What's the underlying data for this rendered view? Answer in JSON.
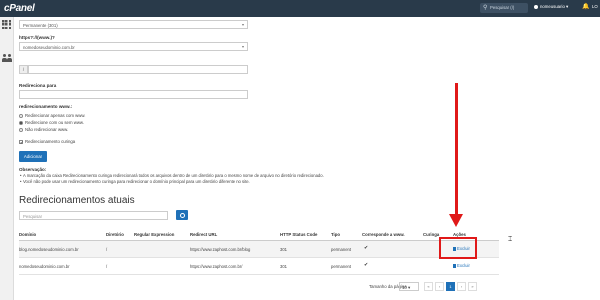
{
  "topbar": {
    "logo": "cPanel",
    "search_placeholder": "Pesquisar (/)",
    "user": "nomeusuario",
    "logout": "LO"
  },
  "form": {
    "type_select": "Permanente (301)",
    "prefix_label": "https?://(www.)?",
    "domain_select": "nomedoseudominio.com.br",
    "path_addon": "/",
    "redirect_label": "Redireciona para",
    "www_label": "redirecionamento www.:",
    "www_options": [
      "Redirecionar apenas com www.",
      "Redirecione com ou sem www.",
      "Não redirecionar www."
    ],
    "wildcard_label": "Redirecionamento curinga",
    "add_button": "Adicionar",
    "notes_title": "Observação:",
    "notes": [
      "A marcação da caixa Redirecionamento curinga redirecionará todos os arquivos dentro de um diretório para o mesmo nome de arquivo no diretório redirecionado.",
      "Você não pode usar um redirecionamento curinga para redirecionar o domínio principal para um diretório diferente no site."
    ]
  },
  "current": {
    "title": "Redirecionamentos atuais",
    "search_placeholder": "Pesquisar",
    "headers": [
      "Domínio",
      "Diretório",
      "Regular Expression",
      "Redirect URL",
      "HTTP Status Code",
      "Tipo",
      "Corresponde a www.",
      "Curinga",
      "Ações"
    ],
    "rows": [
      {
        "domain": "blog.nomedoseudominio.com.br",
        "dir": "/",
        "regex": "",
        "url": "https://www.zaphost.com.br/blog",
        "code": "301",
        "type": "permanent",
        "www": "✔",
        "wildcard": "",
        "action": "Excluir"
      },
      {
        "domain": "nomedoseudominio.com.br",
        "dir": "/",
        "regex": "",
        "url": "https://www.zaphost.com.br/",
        "code": "301",
        "type": "permanent",
        "www": "✔",
        "wildcard": "",
        "action": "Excluir"
      }
    ],
    "page_size_label": "Tamanho da página",
    "page_size": "10",
    "pager": [
      "«",
      "‹",
      "1",
      "›",
      "»"
    ]
  },
  "colors": {
    "topbar": "#293a4a",
    "primary": "#1f71b8",
    "annotation": "#e01919"
  }
}
